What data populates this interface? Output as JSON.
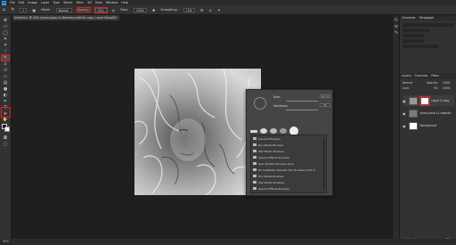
{
  "menubar": {
    "items": [
      "File",
      "Edit",
      "Image",
      "Layer",
      "Type",
      "Select",
      "Filter",
      "3D",
      "View",
      "Window",
      "Help"
    ]
  },
  "optionsbar": {
    "size_value": "1",
    "mode_label": "Mode:",
    "mode_value": "Normal",
    "opacity_label": "Opacity:",
    "opacity_value": "30%",
    "flow_label": "Flow:",
    "flow_value": "100%",
    "smoothing_label": "Smoothing:",
    "smoothing_value": "10%"
  },
  "document": {
    "tab_title": "Untitled-1 @ 50% (shorn-pose-1L-Noisless-realistic copy, Layer Mask/8)*"
  },
  "brush_popup": {
    "size_label": "Size:",
    "size_value": "94 px",
    "hardness_label": "Hardness:",
    "hardness_value": "0%",
    "folders": [
      "General Brushes",
      "Dry Media Brushes",
      "Wet Media Brushes",
      "Special Effects Brushes",
      "Kyle Splatter Brushes (Kyl)",
      "KK ShaKKaN Ultimate Hair Brushes (25X X...",
      "Dry Media Brushes",
      "Wet Media Brushes",
      "Special Effects Brushes",
      "Bristle Brushes",
      "Hair Brushes (Hairs)"
    ]
  },
  "right_panel": {
    "top_tabs": [
      "Character",
      "Paragraph"
    ],
    "layers_tabs": [
      "Layers",
      "Channels",
      "Paths"
    ],
    "blend_mode": "Normal",
    "opacity_label": "Opacity:",
    "opacity_value": "100%",
    "lock_label": "Lock:",
    "fill_label": "Fill:",
    "fill_value": "100%",
    "layers": [
      {
        "name": "Layer 2 copy"
      },
      {
        "name": "shorn-pose-1L-realistic"
      },
      {
        "name": "Background"
      }
    ]
  },
  "statusbar": {
    "zoom": "50%"
  }
}
